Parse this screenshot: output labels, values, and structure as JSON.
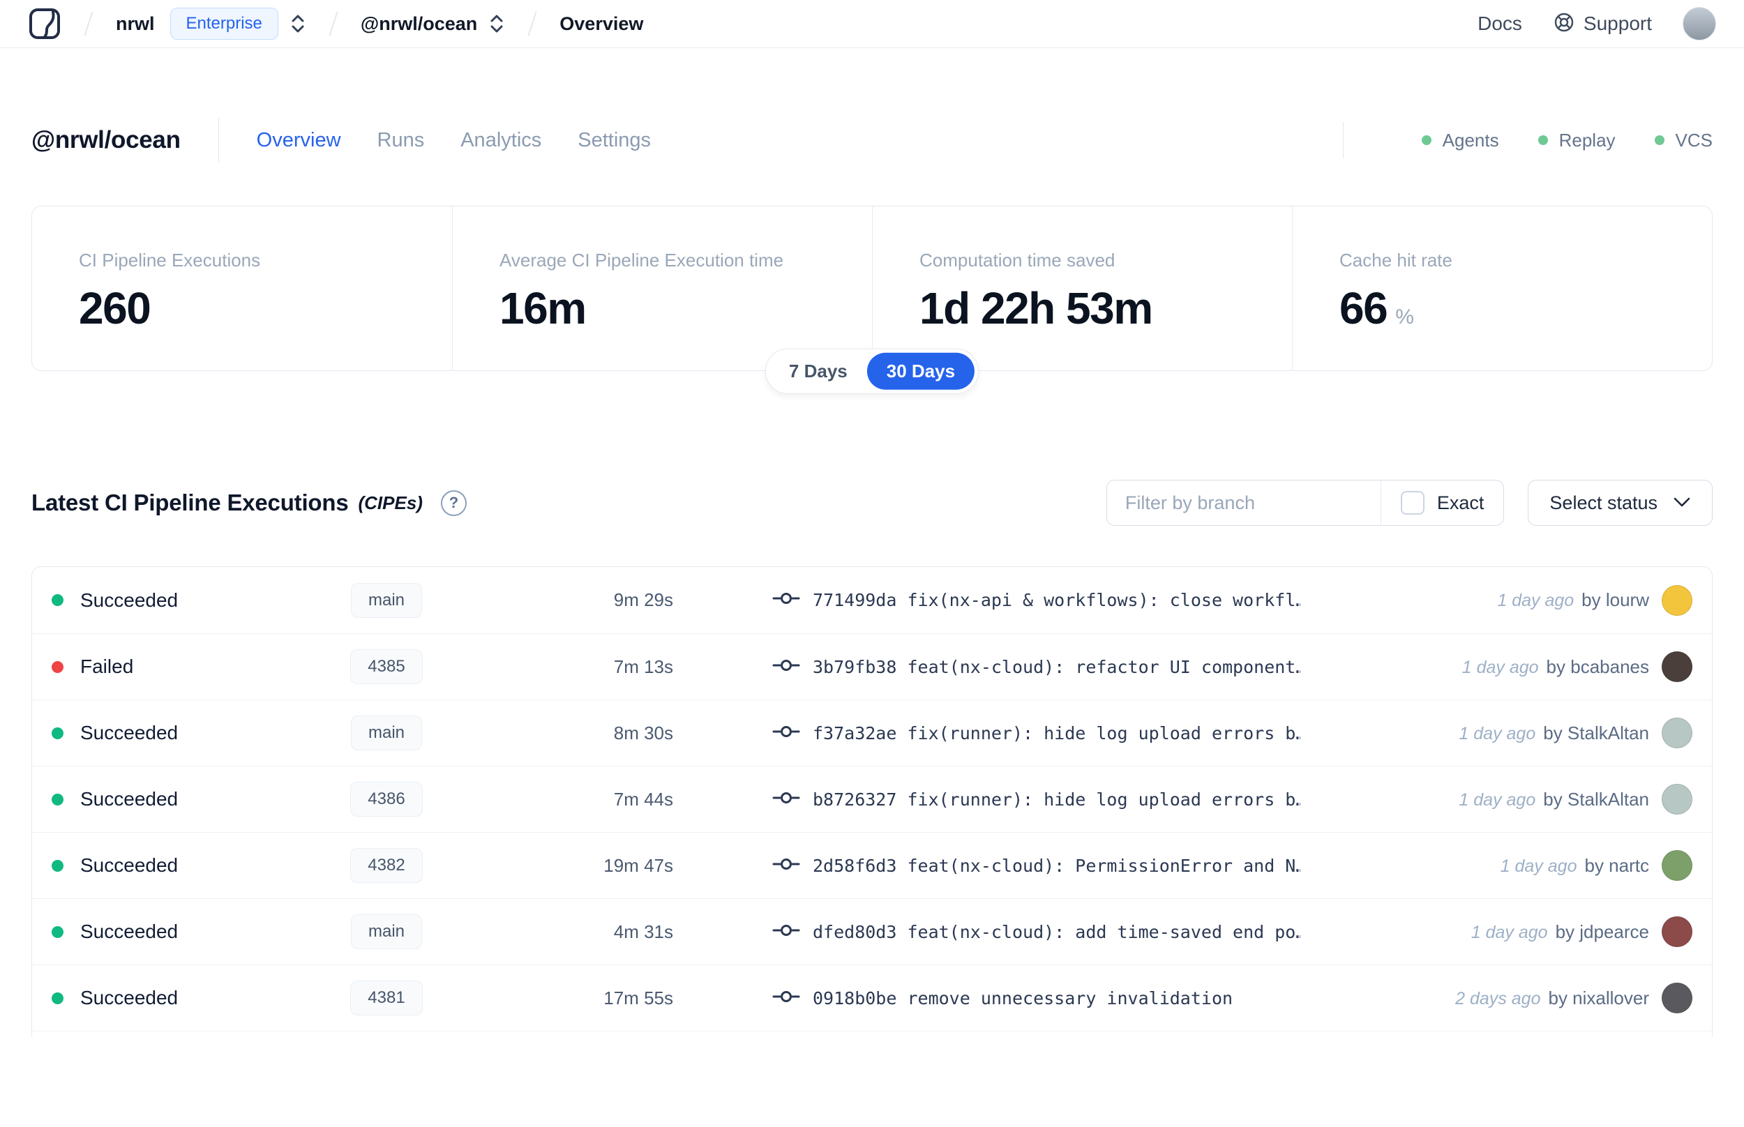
{
  "topnav": {
    "org": "nrwl",
    "org_badge": "Enterprise",
    "workspace": "@nrwl/ocean",
    "page": "Overview",
    "docs_label": "Docs",
    "support_label": "Support",
    "avatar_color": "#8d97a3"
  },
  "header": {
    "title": "@nrwl/ocean",
    "tabs": [
      {
        "label": "Overview",
        "active": true
      },
      {
        "label": "Runs",
        "active": false
      },
      {
        "label": "Analytics",
        "active": false
      },
      {
        "label": "Settings",
        "active": false
      }
    ],
    "env": [
      {
        "label": "Agents"
      },
      {
        "label": "Replay"
      },
      {
        "label": "VCS"
      }
    ],
    "env_dot_color": "#6fc993"
  },
  "stats": {
    "items": [
      {
        "label": "CI Pipeline Executions",
        "value": "260",
        "suffix": ""
      },
      {
        "label": "Average CI Pipeline Execution time",
        "value": "16m",
        "suffix": ""
      },
      {
        "label": "Computation time saved",
        "value": "1d 22h 53m",
        "suffix": ""
      },
      {
        "label": "Cache hit rate",
        "value": "66",
        "suffix": "%"
      }
    ],
    "period_options": [
      {
        "label": "7 Days",
        "active": false
      },
      {
        "label": "30 Days",
        "active": true
      }
    ],
    "active_period_color": "#2563eb"
  },
  "cipes": {
    "title": "Latest CI Pipeline Executions",
    "title_suffix": "(CIPEs)",
    "help_glyph": "?",
    "filter_placeholder": "Filter by branch",
    "exact_label": "Exact",
    "status_select_label": "Select status",
    "status_colors": {
      "succeeded": "#10b981",
      "failed": "#ef4444"
    },
    "rows": [
      {
        "status": "Succeeded",
        "status_color": "#10b981",
        "branch": "main",
        "duration": "9m 29s",
        "commit": "771499da",
        "message": "fix(nx-api & workflows): close workfl…",
        "time": "1 day ago",
        "author": "by lourw",
        "avatar_color": "#f3c53d"
      },
      {
        "status": "Failed",
        "status_color": "#ef4444",
        "branch": "4385",
        "duration": "7m 13s",
        "commit": "3b79fb38",
        "message": "feat(nx-cloud): refactor UI component…",
        "time": "1 day ago",
        "author": "by bcabanes",
        "avatar_color": "#4a3f3a"
      },
      {
        "status": "Succeeded",
        "status_color": "#10b981",
        "branch": "main",
        "duration": "8m 30s",
        "commit": "f37a32ae",
        "message": "fix(runner): hide log upload errors b…",
        "time": "1 day ago",
        "author": "by StalkAltan",
        "avatar_color": "#b7c7c3"
      },
      {
        "status": "Succeeded",
        "status_color": "#10b981",
        "branch": "4386",
        "duration": "7m 44s",
        "commit": "b8726327",
        "message": "fix(runner): hide log upload errors b…",
        "time": "1 day ago",
        "author": "by StalkAltan",
        "avatar_color": "#b7c7c3"
      },
      {
        "status": "Succeeded",
        "status_color": "#10b981",
        "branch": "4382",
        "duration": "19m 47s",
        "commit": "2d58f6d3",
        "message": "feat(nx-cloud): PermissionError and N…",
        "time": "1 day ago",
        "author": "by nartc",
        "avatar_color": "#7da06a"
      },
      {
        "status": "Succeeded",
        "status_color": "#10b981",
        "branch": "main",
        "duration": "4m 31s",
        "commit": "dfed80d3",
        "message": "feat(nx-cloud): add time-saved end po…",
        "time": "1 day ago",
        "author": "by jdpearce",
        "avatar_color": "#8c4a48"
      },
      {
        "status": "Succeeded",
        "status_color": "#10b981",
        "branch": "4381",
        "duration": "17m 55s",
        "commit": "0918b0be",
        "message": "remove unnecessary invalidation",
        "time": "2 days ago",
        "author": "by nixallover",
        "avatar_color": "#5a5a5e"
      }
    ]
  }
}
